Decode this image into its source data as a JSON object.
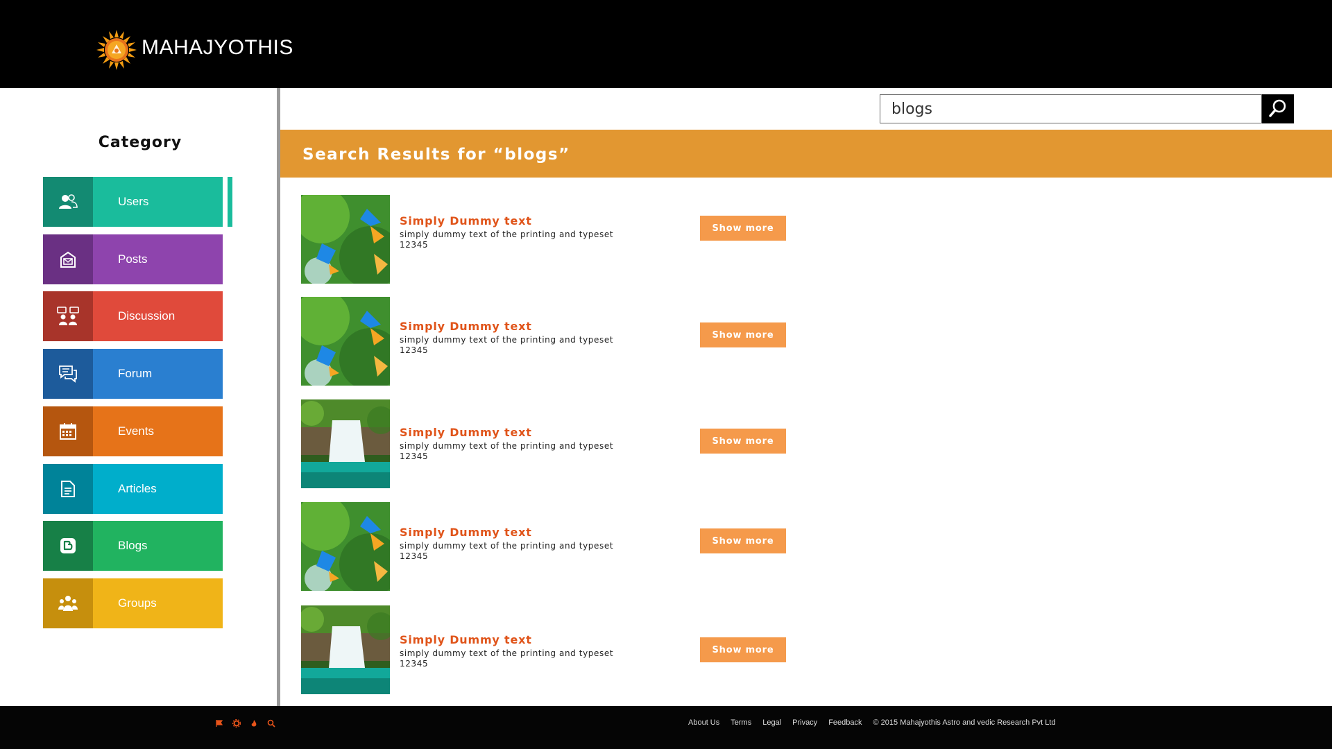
{
  "header": {
    "brand": "MAHAJYOTHIS"
  },
  "sidebar": {
    "title": "Category",
    "items": [
      {
        "label": "Users",
        "icon": "users-icon",
        "color": "#1abc9c",
        "dark": "#138a72"
      },
      {
        "label": "Posts",
        "icon": "posts-icon",
        "color": "#8e44ad",
        "dark": "#6a3083"
      },
      {
        "label": "Discussion",
        "icon": "discussion-icon",
        "color": "#e04a3b",
        "dark": "#a8342a"
      },
      {
        "label": "Forum",
        "icon": "forum-icon",
        "color": "#2a7fd0",
        "dark": "#1d5b9b"
      },
      {
        "label": "Events",
        "icon": "calendar-icon",
        "color": "#e67319",
        "dark": "#b5560f"
      },
      {
        "label": "Articles",
        "icon": "article-icon",
        "color": "#00aecb",
        "dark": "#008399"
      },
      {
        "label": "Blogs",
        "icon": "blogger-icon",
        "color": "#21b360",
        "dark": "#178047"
      },
      {
        "label": "Groups",
        "icon": "groups-icon",
        "color": "#f0b418",
        "dark": "#c68f0d"
      }
    ],
    "active": "Users"
  },
  "search": {
    "value": "blogs"
  },
  "results_header": {
    "title": "Search Results for “blogs”"
  },
  "results": [
    {
      "title": "Simply Dummy text",
      "desc": "simply dummy text of the printing and typeset",
      "code": "12345",
      "image": "kingfisher-image",
      "button": "Show more"
    },
    {
      "title": "Simply Dummy text",
      "desc": "simply dummy text of the printing and typeset",
      "code": "12345",
      "image": "kingfisher-image",
      "button": "Show more"
    },
    {
      "title": "Simply Dummy text",
      "desc": "simply dummy text of the printing and typeset",
      "code": "12345",
      "image": "waterfall-image",
      "button": "Show more"
    },
    {
      "title": "Simply Dummy text",
      "desc": "simply dummy text of the printing and typeset",
      "code": "12345",
      "image": "kingfisher-image",
      "button": "Show more"
    },
    {
      "title": "Simply Dummy text",
      "desc": "simply dummy text of the printing and typeset",
      "code": "12345",
      "image": "waterfall-image",
      "button": "Show more"
    }
  ],
  "footer": {
    "icons": [
      "flag-icon",
      "gear-icon",
      "flame-icon",
      "search-icon"
    ],
    "links": [
      "About Us",
      "Terms",
      "Legal",
      "Privacy",
      "Feedback"
    ],
    "copyright": "© 2015 Mahajyothis Astro and vedic Research Pvt Ltd"
  }
}
